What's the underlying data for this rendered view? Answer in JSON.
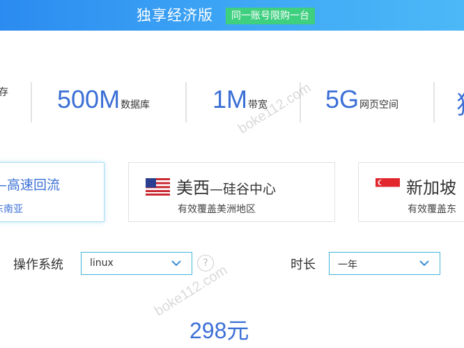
{
  "banner": {
    "title": "独享经济版",
    "badge": "同一账号限购一台"
  },
  "stats": {
    "items": [
      {
        "value": "",
        "unit": "存"
      },
      {
        "value": "500M",
        "unit": "数据库"
      },
      {
        "value": "1M",
        "unit": "带宽"
      },
      {
        "value": "5G",
        "unit": "网页空间"
      },
      {
        "value": "独",
        "unit": ""
      }
    ]
  },
  "regions": [
    {
      "name": "",
      "sub": "—高速回流",
      "cover": "东南亚",
      "flag": "",
      "selected": true
    },
    {
      "name": "美西",
      "sub": "—硅谷中心",
      "cover": "有效覆盖美洲地区",
      "flag": "us-flag-icon"
    },
    {
      "name": "新加坡",
      "sub": "",
      "cover": "有效覆盖东",
      "flag": "singapore-flag-icon"
    }
  ],
  "form": {
    "os_label": "操作系统",
    "os_value": "linux",
    "duration_label": "时长",
    "duration_value": "一年"
  },
  "price": "298元",
  "watermark": [
    "boke112.com",
    "boke112.com"
  ],
  "colors": {
    "accent": "#3b6fd6",
    "banner": "#3ea6f5",
    "badge": "#3ecf7f",
    "select_border": "#3fb5d9"
  }
}
